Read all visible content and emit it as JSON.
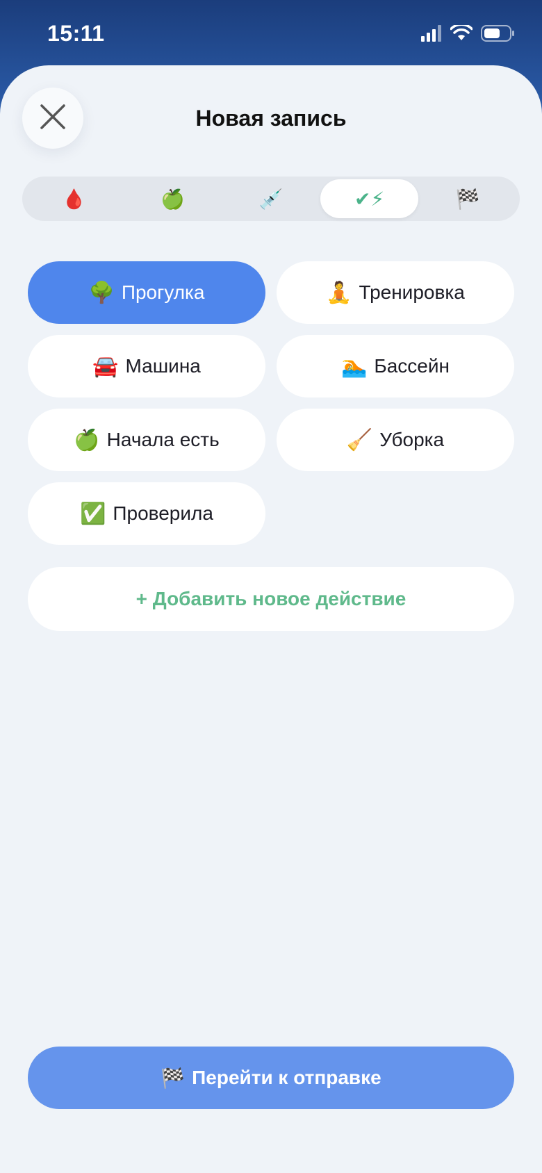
{
  "status_bar": {
    "time": "15:11",
    "icons": [
      "signal-icon",
      "wifi-icon",
      "battery-icon"
    ]
  },
  "header": {
    "title": "Новая запись",
    "close_icon": "close-icon"
  },
  "tabs": [
    {
      "icon": "🩸",
      "name": "blood-drop-icon",
      "active": false
    },
    {
      "icon": "🍏",
      "name": "apple-icon",
      "active": false
    },
    {
      "icon": "💉",
      "name": "syringe-icon",
      "active": false
    },
    {
      "icon": "✔⚡",
      "name": "check-lightning-icon",
      "active": true
    },
    {
      "icon": "🏁",
      "name": "checkered-flag-icon",
      "active": false
    }
  ],
  "actions": [
    {
      "emoji": "🌳",
      "label": "Прогулка",
      "selected": true
    },
    {
      "emoji": "🧘",
      "label": "Тренировка",
      "selected": false
    },
    {
      "emoji": "🚘",
      "label": "Машина",
      "selected": false
    },
    {
      "emoji": "🏊",
      "label": "Бассейн",
      "selected": false
    },
    {
      "emoji": "🍏",
      "label": "Начала есть",
      "selected": false
    },
    {
      "emoji": "🧹",
      "label": "Уборка",
      "selected": false
    },
    {
      "emoji": "✅",
      "label": "Проверила",
      "selected": false
    }
  ],
  "add_action_label": "+ Добавить новое действие",
  "submit": {
    "emoji": "🏁",
    "label": "Перейти к отправке"
  },
  "colors": {
    "accent": "#4f86ec",
    "submit": "#6594ec",
    "add_text": "#5fb98b",
    "sheet_bg": "#eff3f8",
    "header_bg": "#1b3d7c"
  }
}
